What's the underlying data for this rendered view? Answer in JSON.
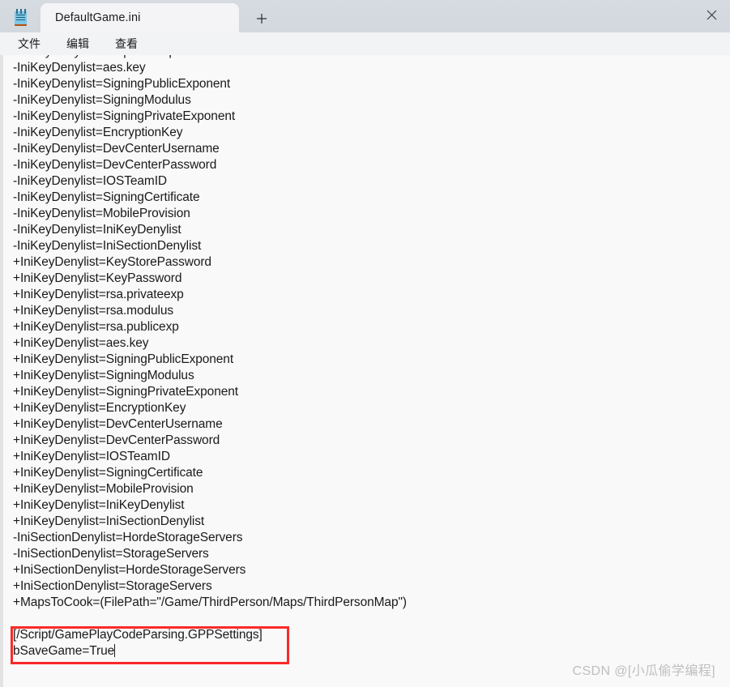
{
  "window": {
    "app_icon": "notepad-icon",
    "titlebar_color": "#d4d9e0",
    "menubar_color": "#f2f3f5",
    "editor_background": "#f9f9f9"
  },
  "tab": {
    "title": "DefaultGame.ini",
    "close_icon": "close-icon",
    "new_tab_icon": "plus-icon"
  },
  "menubar": {
    "items": [
      {
        "label": "文件"
      },
      {
        "label": "编辑"
      },
      {
        "label": "查看"
      }
    ]
  },
  "editor": {
    "first_line_clipped": true,
    "lines": [
      "-IniKeyDenylist=rsa.publicexp",
      "-IniKeyDenylist=aes.key",
      "-IniKeyDenylist=SigningPublicExponent",
      "-IniKeyDenylist=SigningModulus",
      "-IniKeyDenylist=SigningPrivateExponent",
      "-IniKeyDenylist=EncryptionKey",
      "-IniKeyDenylist=DevCenterUsername",
      "-IniKeyDenylist=DevCenterPassword",
      "-IniKeyDenylist=IOSTeamID",
      "-IniKeyDenylist=SigningCertificate",
      "-IniKeyDenylist=MobileProvision",
      "-IniKeyDenylist=IniKeyDenylist",
      "-IniKeyDenylist=IniSectionDenylist",
      "+IniKeyDenylist=KeyStorePassword",
      "+IniKeyDenylist=KeyPassword",
      "+IniKeyDenylist=rsa.privateexp",
      "+IniKeyDenylist=rsa.modulus",
      "+IniKeyDenylist=rsa.publicexp",
      "+IniKeyDenylist=aes.key",
      "+IniKeyDenylist=SigningPublicExponent",
      "+IniKeyDenylist=SigningModulus",
      "+IniKeyDenylist=SigningPrivateExponent",
      "+IniKeyDenylist=EncryptionKey",
      "+IniKeyDenylist=DevCenterUsername",
      "+IniKeyDenylist=DevCenterPassword",
      "+IniKeyDenylist=IOSTeamID",
      "+IniKeyDenylist=SigningCertificate",
      "+IniKeyDenylist=MobileProvision",
      "+IniKeyDenylist=IniKeyDenylist",
      "+IniKeyDenylist=IniSectionDenylist",
      "-IniSectionDenylist=HordeStorageServers",
      "-IniSectionDenylist=StorageServers",
      "+IniSectionDenylist=HordeStorageServers",
      "+IniSectionDenylist=StorageServers",
      "+MapsToCook=(FilePath=\"/Game/ThirdPerson/Maps/ThirdPersonMap\")",
      "",
      "[/Script/GamePlayCodeParsing.GPPSettings]",
      "bSaveGame=True"
    ]
  },
  "highlight": {
    "color": "#fa2a29",
    "target_lines": [
      "[/Script/GamePlayCodeParsing.GPPSettings]",
      "bSaveGame=True"
    ]
  },
  "watermark": {
    "text": "CSDN @[小瓜偷学编程]",
    "color": "#bfbfbf"
  }
}
